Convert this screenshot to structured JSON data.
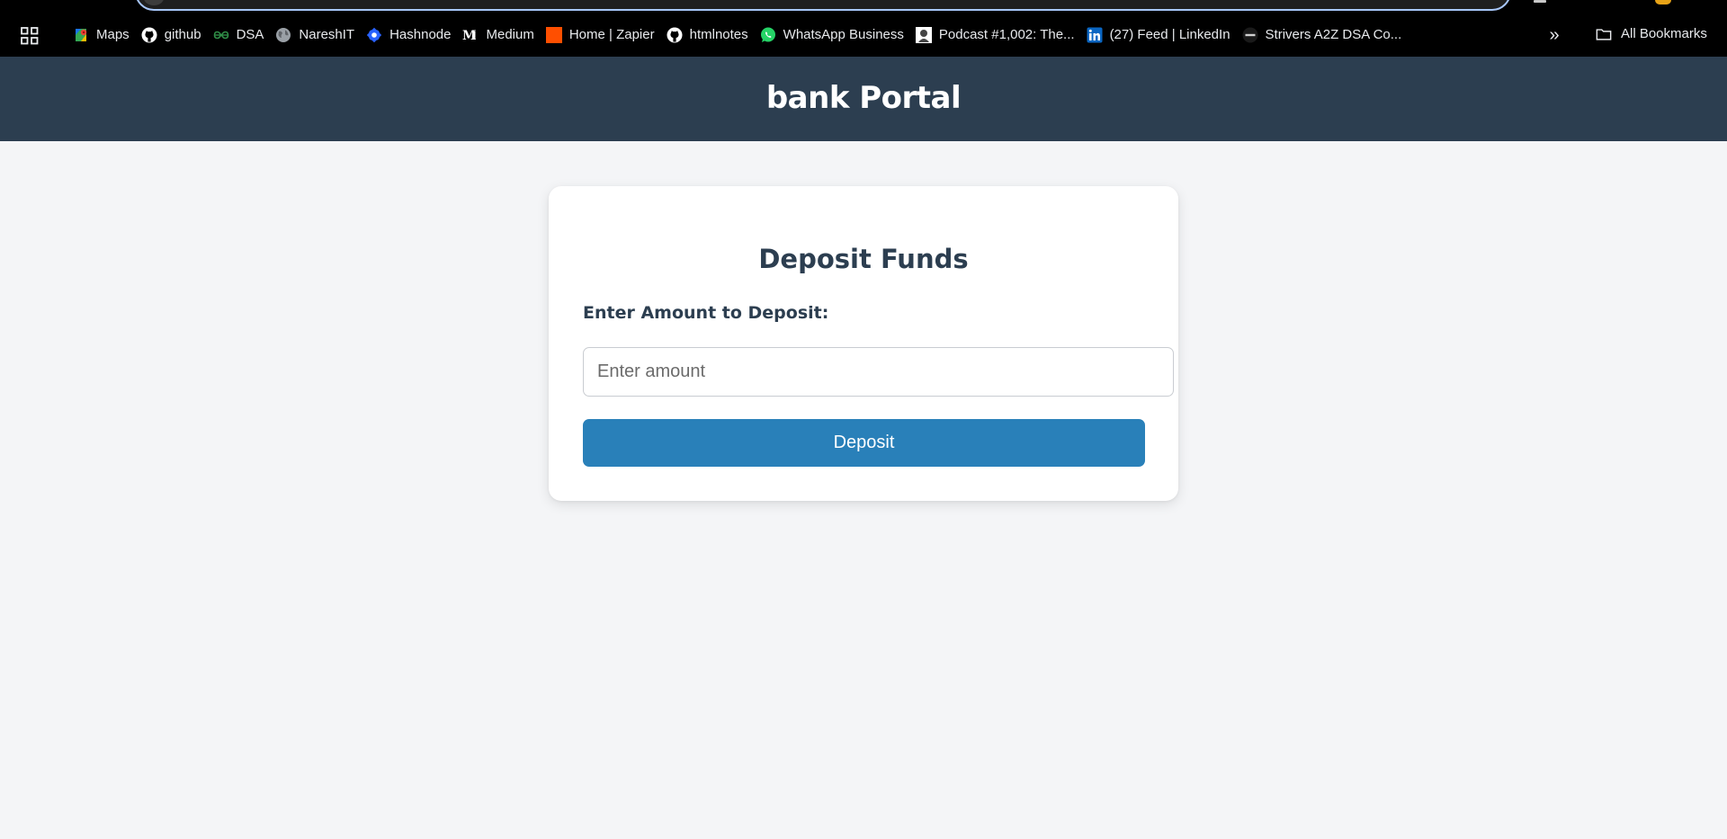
{
  "browser": {
    "bookmarks": [
      {
        "label": "Maps",
        "icon": "google-maps-icon"
      },
      {
        "label": "github",
        "icon": "github-icon"
      },
      {
        "label": "DSA",
        "icon": "geeksforgeeks-icon"
      },
      {
        "label": "NareshIT",
        "icon": "globe-icon"
      },
      {
        "label": "Hashnode",
        "icon": "hashnode-icon"
      },
      {
        "label": "Medium",
        "icon": "medium-icon"
      },
      {
        "label": "Home | Zapier",
        "icon": "zapier-icon"
      },
      {
        "label": "htmlnotes",
        "icon": "github-icon"
      },
      {
        "label": "WhatsApp Business",
        "icon": "whatsapp-icon"
      },
      {
        "label": "Podcast #1,002: The...",
        "icon": "podcast-icon"
      },
      {
        "label": "(27) Feed | LinkedIn",
        "icon": "linkedin-icon"
      },
      {
        "label": "Strivers A2Z DSA Co...",
        "icon": "tuf-icon"
      }
    ],
    "overflow_label": "»",
    "all_bookmarks_label": "All Bookmarks"
  },
  "header": {
    "title": "bank Portal"
  },
  "deposit_form": {
    "title": "Deposit Funds",
    "amount_label": "Enter Amount to Deposit:",
    "amount_value": "",
    "amount_placeholder": "Enter amount",
    "submit_label": "Deposit"
  },
  "colors": {
    "header_bg": "#2c3e50",
    "page_bg": "#f4f5f7",
    "button_bg": "#2980b9",
    "text_dark": "#2c3e50"
  }
}
